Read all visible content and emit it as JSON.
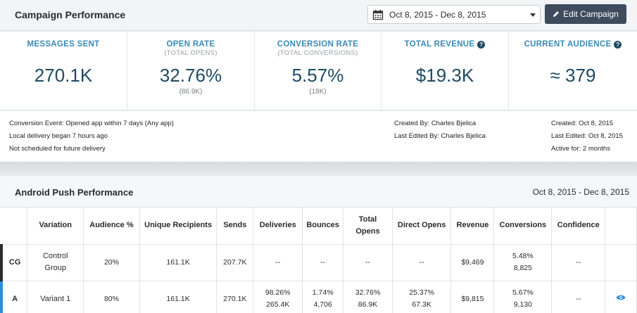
{
  "header": {
    "title": "Campaign Performance",
    "date_range": "Oct 8, 2015 - Dec 8, 2015",
    "edit_button": "Edit Campaign"
  },
  "stats": [
    {
      "label": "MESSAGES SENT",
      "sublabel": "",
      "value": "270.1K",
      "subvalue": "",
      "help": false
    },
    {
      "label": "OPEN RATE",
      "sublabel": "(TOTAL OPENS)",
      "value": "32.76%",
      "subvalue": "(86.9K)",
      "help": false
    },
    {
      "label": "CONVERSION RATE",
      "sublabel": "(TOTAL CONVERSIONS)",
      "value": "5.57%",
      "subvalue": "(18K)",
      "help": false
    },
    {
      "label": "TOTAL REVENUE",
      "sublabel": "",
      "value": "$19.3K",
      "subvalue": "",
      "help": true
    },
    {
      "label": "CURRENT AUDIENCE",
      "sublabel": "",
      "value": "≈ 379",
      "subvalue": "",
      "help": true
    }
  ],
  "meta": {
    "conversion_event": "Conversion Event: Opened app within 7 days (Any app)",
    "local_delivery": "Local delivery began 7 hours ago",
    "not_scheduled": "Not scheduled for future delivery",
    "created_by_label": "Created By:",
    "created_by": "Charles Bjelica",
    "last_edited_by_label": "Last Edited By:",
    "last_edited_by": "Charles Bjelica",
    "created_label": "Created:",
    "created": "Oct 8, 2015",
    "last_edited_label": "Last Edited:",
    "last_edited": "Oct 8, 2015",
    "active_for_label": "Active for:",
    "active_for": "2 months"
  },
  "android": {
    "title": "Android Push Performance",
    "date_range": "Oct 8, 2015 - Dec 8, 2015",
    "columns": [
      "",
      "Variation",
      "Audience %",
      "Unique Recipients",
      "Sends",
      "Deliveries",
      "Bounces",
      "Total Opens",
      "Direct Opens",
      "Revenue",
      "Conversions",
      "Confidence",
      ""
    ],
    "rows": [
      {
        "id": "CG",
        "variation": "Control Group",
        "audience": "20%",
        "unique": "161.1K",
        "sends": "207.7K",
        "deliveries": "--",
        "deliveries2": "",
        "bounces": "--",
        "bounces2": "",
        "total_opens": "--",
        "total_opens2": "",
        "direct_opens": "--",
        "direct_opens2": "",
        "revenue": "$9,469",
        "conversions": "5.48%",
        "conversions2": "8,825",
        "confidence": "--"
      },
      {
        "id": "A",
        "variation": "Variant 1",
        "audience": "80%",
        "unique": "161.1K",
        "sends": "270.1K",
        "deliveries": "98.26%",
        "deliveries2": "265.4K",
        "bounces": "1.74%",
        "bounces2": "4,706",
        "total_opens": "32.76%",
        "total_opens2": "86.9K",
        "direct_opens": "25.37%",
        "direct_opens2": "67.3K",
        "revenue": "$9,815",
        "conversions": "5.67%",
        "conversions2": "9,130",
        "confidence": "--"
      }
    ]
  }
}
